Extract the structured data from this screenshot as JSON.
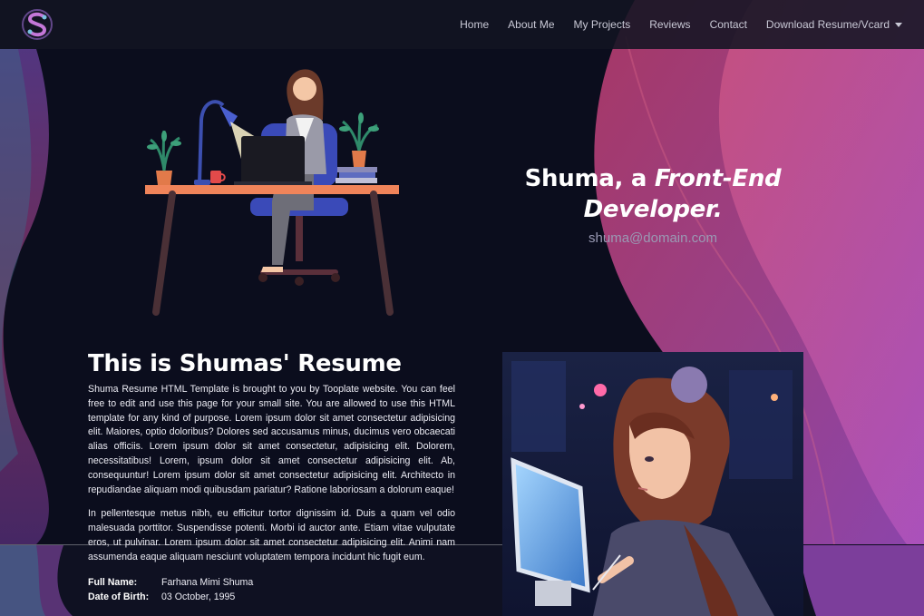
{
  "nav": {
    "links": [
      "Home",
      "About Me",
      "My Projects",
      "Reviews",
      "Contact"
    ],
    "dropdown_label": "Download Resume/Vcard"
  },
  "hero": {
    "title_prefix": "Shuma, a ",
    "title_emphasis": "Front-End Developer.",
    "email": "shuma@domain.com"
  },
  "resume": {
    "title": "This is Shumas' Resume",
    "paragraph1": "Shuma Resume HTML Template is brought to you by Tooplate website. You can feel free to edit and use this page for your small site. You are allowed to use this HTML template for any kind of purpose. Lorem ipsum dolor sit amet consectetur adipisicing elit. Maiores, optio doloribus? Dolores sed accusamus minus, ducimus vero obcaecati alias officiis. Lorem ipsum dolor sit amet consectetur, adipisicing elit. Dolorem, necessitatibus! Lorem, ipsum dolor sit amet consectetur adipisicing elit. Ab, consequuntur! Lorem ipsum dolor sit amet consectetur adipisicing elit. Architecto in repudiandae aliquam modi quibusdam pariatur? Ratione laboriosam a dolorum eaque!",
    "paragraph2": "In pellentesque metus nibh, eu efficitur tortor dignissim id. Duis a quam vel odio malesuada porttitor. Suspendisse potenti. Morbi id auctor ante. Etiam vitae vulputate eros, ut pulvinar. Lorem ipsum dolor sit amet consectetur adipisicing elit. Animi nam assumenda eaque aliquam nesciunt voluptatem tempora incidunt hic fugit eum.",
    "info": [
      {
        "label": "Full Name:",
        "value": "Farhana Mimi Shuma"
      },
      {
        "label": "Date of Birth:",
        "value": "03 October, 1995"
      }
    ]
  },
  "colors": {
    "background": "#0b0d1d",
    "wave_pink": "#c0397a",
    "wave_purple": "#9b3fb5",
    "navbar": "#121422"
  },
  "icons": {
    "logo": "s-circuit-logo",
    "dropdown": "caret-down-icon"
  }
}
